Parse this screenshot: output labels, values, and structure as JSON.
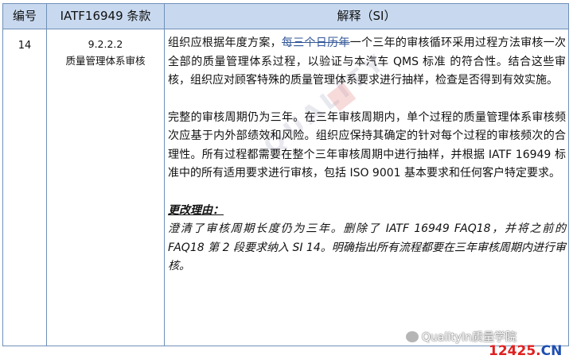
{
  "table": {
    "headers": [
      "编号",
      "IATF16949 条款",
      "解释（SI）"
    ],
    "row": {
      "number": "14",
      "clause_code": "9.2.2.2",
      "clause_title": "质量管理体系审核",
      "para1_a": "组织应根据年度方案，",
      "para1_struck": "每三个日历年",
      "para1_b": "一个三年的审核循环采用过程方法审核一次全部的质量管理体系过程，以验证与本汽车 QMS 标准 的符合性。结合这些审核，组织应对顾客特殊的质量管理体系要求进行抽样，检查是否得到有效实施。",
      "para2": "完整的审核周期仍为三年。在三年审核周期内，单个过程的质量管理体系审核频次应基于内外部绩效和风险。组织应保持其确定的针对每个过程的审核频次的合理性。所有过程都需要在整个三年审核周期中进行抽样，并根据 IATF 16949 标准中的所有适用要求进行审核，包括 ISO 9001 基本要求和任何客户特定要求。",
      "reason_title": "更改理由：",
      "reason_text": "澄清了审核周期长度仍为三年。删除了 IATF 16949 FAQ18，并将之前的 FAQ18 第 2 段要求纳入 SI 14。明确指出所有流程都要在三年审核周期内进行审核。"
    }
  },
  "watermark": {
    "text": "QUALITY"
  },
  "overlay": {
    "account": "QualityIn质量学院",
    "site_red": "12425.",
    "site_blue": "CN"
  },
  "colors": {
    "header_bg": "#c8d9ef",
    "border": "#6f8fb8",
    "strike": "#2f5597",
    "site_red": "#e02020",
    "site_blue": "#1f4fb0"
  }
}
